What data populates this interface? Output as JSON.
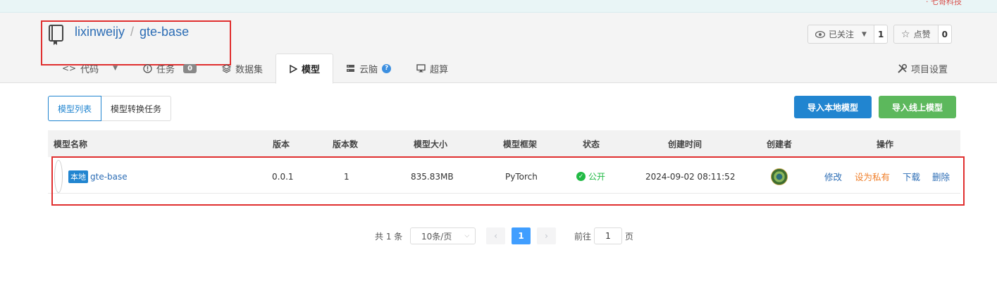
{
  "topbar": {
    "corner_text": "· 七哥科技"
  },
  "repo": {
    "owner": "lixinweijy",
    "separator": "/",
    "name": "gte-base"
  },
  "header_actions": {
    "watch": {
      "label": "已关注",
      "count": "1"
    },
    "star": {
      "label": "点赞",
      "count": "0"
    }
  },
  "tabs": [
    {
      "label": "代码",
      "icon": "code-icon"
    },
    {
      "label": "任务",
      "icon": "issue-icon",
      "badge": "0"
    },
    {
      "label": "数据集",
      "icon": "layers-icon"
    },
    {
      "label": "模型",
      "icon": "play-icon",
      "active": true
    },
    {
      "label": "云脑",
      "icon": "server-icon"
    },
    {
      "label": "超算",
      "icon": "monitor-icon"
    }
  ],
  "project_settings": "项目设置",
  "subtabs": {
    "model_list": "模型列表",
    "convert_tasks": "模型转换任务"
  },
  "buttons": {
    "import_local": "导入本地模型",
    "import_online": "导入线上模型"
  },
  "colors": {
    "primary_blue": "#2185d0",
    "green": "#5cb85c",
    "link": "#2c6db5",
    "orange": "#f0802c",
    "danger_outline": "#e02f2f"
  },
  "table": {
    "headers": [
      "模型名称",
      "版本",
      "版本数",
      "模型大小",
      "模型框架",
      "状态",
      "创建时间",
      "创建者",
      "操作"
    ],
    "rows": [
      {
        "tag": "本地",
        "name": "gte-base",
        "version": "0.0.1",
        "version_count": "1",
        "size": "835.83MB",
        "framework": "PyTorch",
        "status": "公开",
        "created": "2024-09-02 08:11:52",
        "actions": {
          "edit": "修改",
          "make_private": "设为私有",
          "download": "下载",
          "delete": "删除"
        }
      }
    ]
  },
  "pagination": {
    "total": "共 1 条",
    "page_size": "10条/页",
    "current": "1",
    "goto_prefix": "前往",
    "goto_value": "1",
    "goto_suffix": "页"
  }
}
